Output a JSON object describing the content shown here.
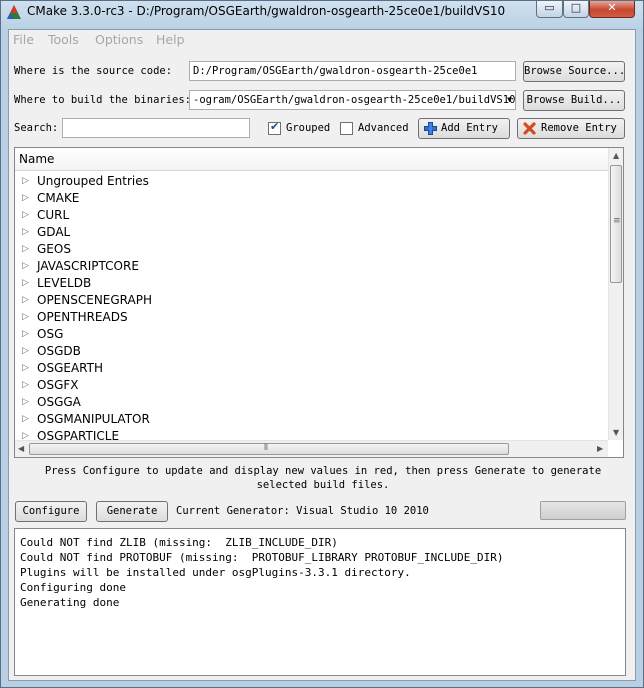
{
  "window": {
    "title": "CMake 3.3.0-rc3 - D:/Program/OSGEarth/gwaldron-osgearth-25ce0e1/buildVS10",
    "controls": {
      "minimize": "▭",
      "maximize": "□",
      "close": "✕"
    }
  },
  "menu": [
    "File",
    "Tools",
    "Options",
    "Help"
  ],
  "source": {
    "label": "Where is the source code:",
    "value": "D:/Program/OSGEarth/gwaldron-osgearth-25ce0e1",
    "button": "Browse Source..."
  },
  "build": {
    "label": "Where to build the binaries:",
    "value": "-ogram/OSGEarth/gwaldron-osgearth-25ce0e1/buildVS10",
    "button": "Browse Build..."
  },
  "search": {
    "label": "Search:",
    "value": ""
  },
  "grouped": {
    "label": "Grouped",
    "checked": true
  },
  "advanced": {
    "label": "Advanced",
    "checked": false
  },
  "add_entry": "Add Entry",
  "remove_entry": "Remove Entry",
  "tree": {
    "header": "Name",
    "items": [
      "Ungrouped Entries",
      "CMAKE",
      "CURL",
      "GDAL",
      "GEOS",
      "JAVASCRIPTCORE",
      "LEVELDB",
      "OPENSCENEGRAPH",
      "OPENTHREADS",
      "OSG",
      "OSGDB",
      "OSGEARTH",
      "OSGFX",
      "OSGGA",
      "OSGMANIPULATOR",
      "OSGPARTICLE"
    ]
  },
  "hint": "Press Configure to update and display new values in red, then press Generate to generate selected build files.",
  "configure_button": "Configure",
  "generate_button": "Generate",
  "current_generator": "Current Generator: Visual Studio 10 2010",
  "output": [
    "Could NOT find ZLIB (missing:  ZLIB_INCLUDE_DIR)",
    "Could NOT find PROTOBUF (missing:  PROTOBUF_LIBRARY PROTOBUF_INCLUDE_DIR)",
    "Plugins will be installed under osgPlugins-3.3.1 directory.",
    "Configuring done",
    "Generating done"
  ],
  "icons": {
    "expand": "expand-triangle-icon",
    "add": "plus-icon",
    "remove": "red-x-icon",
    "app": "cmake-triangle-icon"
  },
  "colors": {
    "add_icon": "#2d6fd3",
    "remove_icon": "#d94a1e",
    "close_button": "#c6482f"
  }
}
